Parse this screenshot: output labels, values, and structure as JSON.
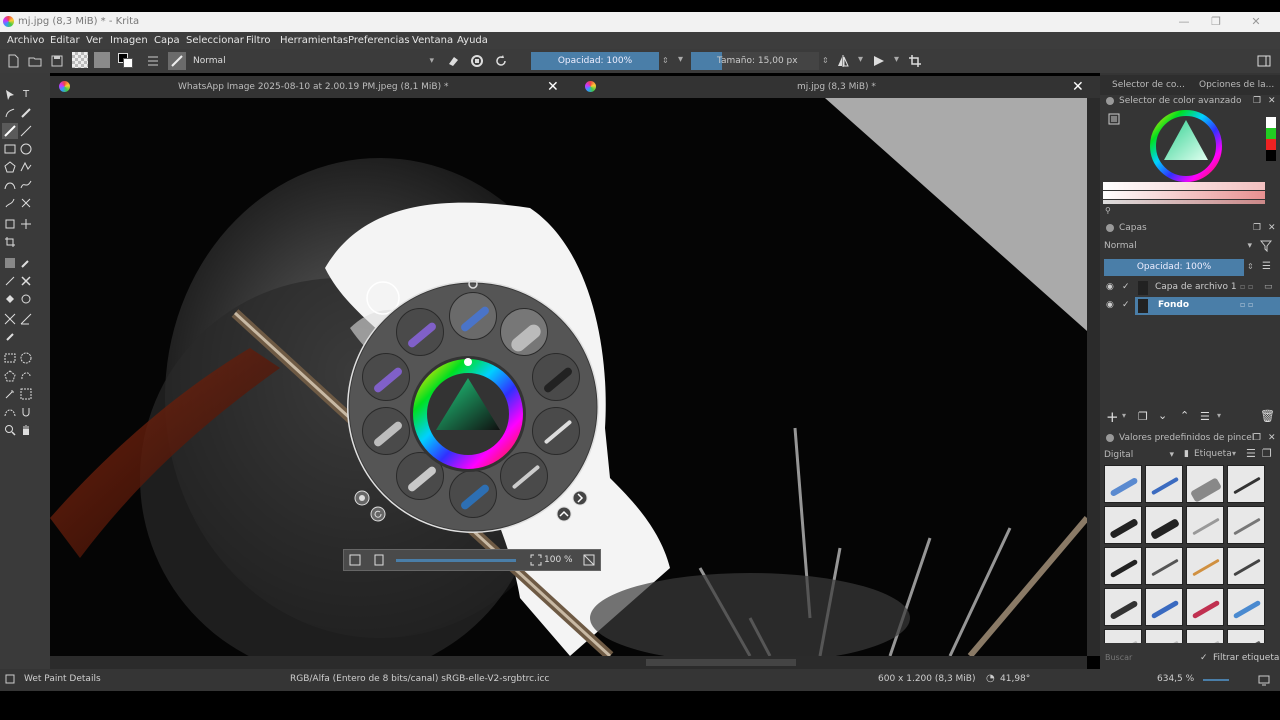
{
  "window": {
    "title": "mj.jpg (8,3 MiB) * - Krita"
  },
  "menu": [
    "Archivo",
    "Editar",
    "Ver",
    "Imagen",
    "Capa",
    "Seleccionar",
    "Filtro",
    "Herramientas",
    "Preferencias",
    "Ventana",
    "Ayuda"
  ],
  "toolbar": {
    "blend_mode": "Normal",
    "opacity": "Opacidad: 100%",
    "size": "Tamaño: 15,00 px"
  },
  "tabs": [
    {
      "label": "WhatsApp Image 2025-08-10 at 2.00.19 PM.jpeg (8,1 MiB) *"
    },
    {
      "label": "mj.jpg (8,3 MiB) *"
    }
  ],
  "palette": {
    "zoom": "100 %"
  },
  "dock": {
    "tab_color": "Selector de co...",
    "tab_options": "Opciones de la...",
    "color_panel_title": "Selector de color avanzado",
    "layers_title": "Capas",
    "layers_blend": "Normal",
    "layers_opacity": "Opacidad: 100%",
    "layers": [
      {
        "name": "Capa de archivo 1",
        "selected": false
      },
      {
        "name": "Fondo",
        "selected": true
      }
    ],
    "presets_title": "Valores predefinidos de pincel",
    "preset_tag": "Digital",
    "preset_label": "Etiqueta",
    "search_placeholder": "Buscar",
    "filter_label": "Filtrar etiqueta"
  },
  "status": {
    "left": "Wet Paint Details",
    "colorspace": "RGB/Alfa (Entero de 8 bits/canal)  sRGB-elle-V2-srgbtrc.icc",
    "dimensions": "600 x 1.200 (8,3 MiB)",
    "angle": "41,98°",
    "zoom": "634,5 %"
  },
  "colors": {
    "accent": "#4a7ea8",
    "panel": "#353535",
    "canvas": "#050505"
  }
}
